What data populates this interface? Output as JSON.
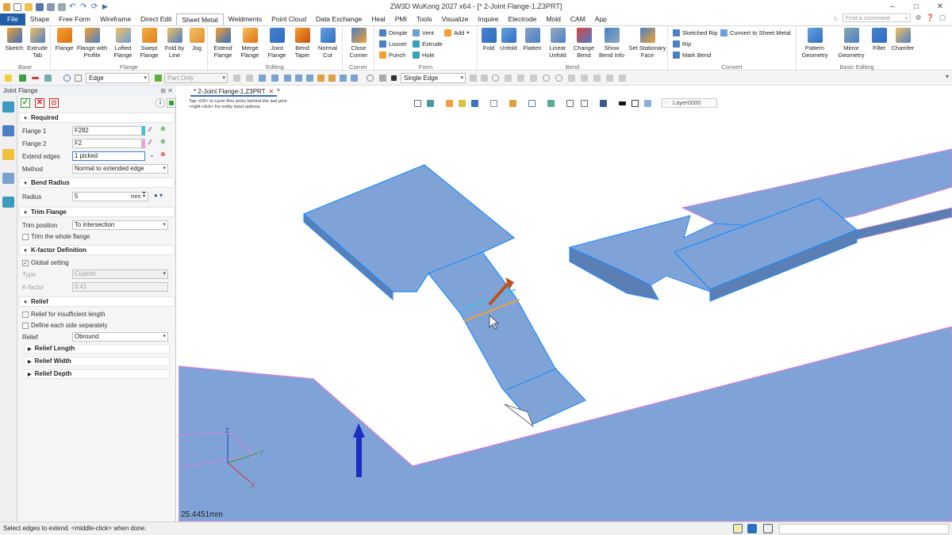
{
  "app": {
    "title": "ZW3D WuKong 2027 x64 - [* 2-Joint Flange-1.Z3PRT]"
  },
  "menu": {
    "file": "File",
    "tabs": [
      "Shape",
      "Free Form",
      "Wireframe",
      "Direct Edit",
      "Sheet Metal",
      "Weldments",
      "Point Cloud",
      "Data Exchange",
      "Heal",
      "PMI",
      "Tools",
      "Visualize",
      "Inquire",
      "Electrode",
      "Mold",
      "CAM",
      "App"
    ],
    "active_tab": "Sheet Metal",
    "search_placeholder": "Find a command"
  },
  "ribbon": {
    "groups": {
      "base": "Base",
      "flange": "Flange",
      "editing": "Editing",
      "corner": "Corner",
      "form": "Form",
      "bend": "Bend",
      "convert": "Convert",
      "basic_editing": "Basic Editing"
    },
    "buttons": {
      "sketch": "Sketch",
      "extrude_tab": "Extrude Tab",
      "flange": "Flange",
      "flange_profile": "Flange with Profile",
      "lofted_flange": "Lofted Flange",
      "swept_flange": "Swept Flange",
      "fold_by_line": "Fold by Line",
      "jog": "Jog",
      "extend_flange": "Extend Flange",
      "merge_flange": "Merge Flange",
      "joint_flange": "Joint Flange",
      "bend_taper": "Bend Taper",
      "normal_cut": "Normal Cut",
      "close_corner": "Close Corner",
      "dimple": "Dimple",
      "vent": "Vent",
      "add": "Add",
      "louver": "Louver",
      "extrude": "Extrude",
      "punch": "Punch",
      "hole": "Hole",
      "fold": "Fold",
      "unfold": "Unfold",
      "flatten": "Flatten",
      "linear_unfold": "Linear Unfold",
      "change_bend": "Change Bend",
      "show_bend_info": "Show Bend Info",
      "set_stationary_face": "Set Stationary Face",
      "sketched_rip": "Sketched Rip",
      "convert_sheet_metal": "Convert to Sheet Metal",
      "rip": "Rip",
      "mark_bend": "Mark Bend",
      "pattern_geometry": "Pattern Geometry",
      "mirror_geometry": "Mirror Geometry",
      "fillet": "Fillet",
      "chamfer": "Chamfer"
    }
  },
  "toolbar": {
    "filter": "Edge",
    "scope": "Part Only",
    "pick_mode": "Single Edge"
  },
  "panel": {
    "title": "Joint Flange",
    "sections": {
      "required": "Required",
      "bend_radius": "Bend Radius",
      "trim_flange": "Trim Flange",
      "kfactor": "K-factor Definition",
      "relief": "Relief"
    },
    "flange1": {
      "label": "Flange 1",
      "value": "F282"
    },
    "flange2": {
      "label": "Flange 2",
      "value": "F2"
    },
    "extend_edges": {
      "label": "Extend edges",
      "value": "1 picked"
    },
    "method": {
      "label": "Method",
      "value": "Normal to extended edge"
    },
    "radius": {
      "label": "Radius",
      "value": "5",
      "unit": "mm"
    },
    "trim_position": {
      "label": "Trim position",
      "value": "To intersection"
    },
    "trim_whole": {
      "label": "Trim the whole flange",
      "checked": false
    },
    "global_setting": {
      "label": "Global setting",
      "checked": true
    },
    "type": {
      "label": "Type",
      "value": "Custom"
    },
    "kfactor": {
      "label": "K-factor",
      "value": "0.41"
    },
    "relief_insufficient": {
      "label": "Relief for insufficient length",
      "checked": false
    },
    "define_each": {
      "label": "Define each side separately",
      "checked": false
    },
    "relief": {
      "label": "Relief",
      "value": "Obround"
    },
    "relief_length": "Relief Length",
    "relief_width": "Relief Width",
    "relief_depth": "Relief Depth"
  },
  "document": {
    "tab": "* 2-Joint Flange-1.Z3PRT"
  },
  "viewport": {
    "hint_line1": "Tap <F8> to cycle thru picks behind the last pick.",
    "hint_line2": "<right-click> for entity input options.",
    "layer": "Layer0000",
    "measure": "25.4451mm",
    "axes": {
      "x": "X",
      "y": "Y",
      "z": "Z"
    }
  },
  "status": {
    "text": "Select edges to extend. <middle-click> when done."
  },
  "colors": {
    "accent": "#1f5fa8",
    "part_fill": "#7fa3d6",
    "highlight_edge": "#1a8cff",
    "flange_edge": "#e080e0"
  }
}
